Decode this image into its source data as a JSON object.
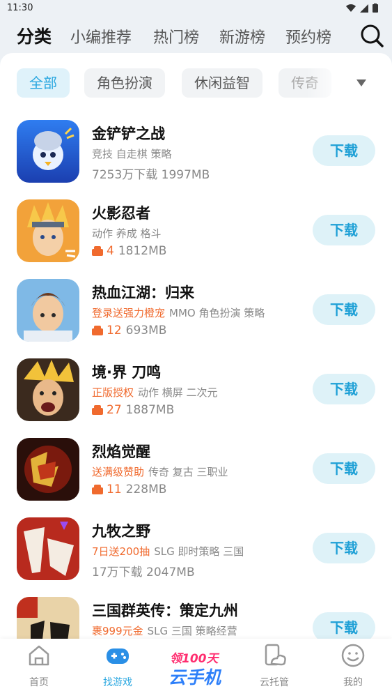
{
  "status_bar": {
    "time": "11:30"
  },
  "top_nav": {
    "tabs": [
      {
        "label": "分类",
        "active": true
      },
      {
        "label": "小编推荐",
        "active": false
      },
      {
        "label": "热门榜",
        "active": false
      },
      {
        "label": "新游榜",
        "active": false
      },
      {
        "label": "预约榜",
        "active": false
      }
    ]
  },
  "chips": [
    {
      "label": "全部",
      "active": true
    },
    {
      "label": "角色扮演",
      "active": false
    },
    {
      "label": "休闲益智",
      "active": false
    },
    {
      "label": "传奇",
      "active": false
    }
  ],
  "games": [
    {
      "name": "金铲铲之战",
      "promo": "",
      "tags": "竞技 自走棋 策略",
      "gift": "",
      "stats": "7253万下载 1997MB",
      "button": "下载"
    },
    {
      "name": "火影忍者",
      "promo": "",
      "tags": "动作 养成 格斗",
      "gift": "4",
      "stats": "1812MB",
      "button": "下载"
    },
    {
      "name": "热血江湖：归来",
      "promo": "登录送强力橙宠",
      "tags": "MMO 角色扮演 策略",
      "gift": "12",
      "stats": "693MB",
      "button": "下载"
    },
    {
      "name": "境·界 刀鸣",
      "promo": "正版授权",
      "tags": "动作 横屏 二次元",
      "gift": "27",
      "stats": "1887MB",
      "button": "下载"
    },
    {
      "name": "烈焰觉醒",
      "promo": "送满级赞助",
      "tags": "传奇 复古 三职业",
      "gift": "11",
      "stats": "228MB",
      "button": "下载"
    },
    {
      "name": "九牧之野",
      "promo": "7日送200抽",
      "tags": "SLG 即时策略 三国",
      "gift": "",
      "stats": "17万下载 2047MB",
      "button": "下载"
    },
    {
      "name": "三国群英传：策定九州",
      "promo": "裹999元金",
      "tags": "SLG 三国 策略经营",
      "gift": "",
      "stats": "",
      "button": "下载"
    }
  ],
  "bottom_nav": {
    "items": [
      {
        "label": "首页",
        "active": false
      },
      {
        "label": "找游戏",
        "active": true
      },
      {
        "label": "云托管",
        "active": false
      },
      {
        "label": "我的",
        "active": false
      }
    ],
    "promo": {
      "line1": "领100天",
      "line2": "云手机"
    }
  },
  "colors": {
    "accent": "#2aa7e0",
    "promo": "#f06a2e",
    "button_bg": "#def2f8"
  }
}
